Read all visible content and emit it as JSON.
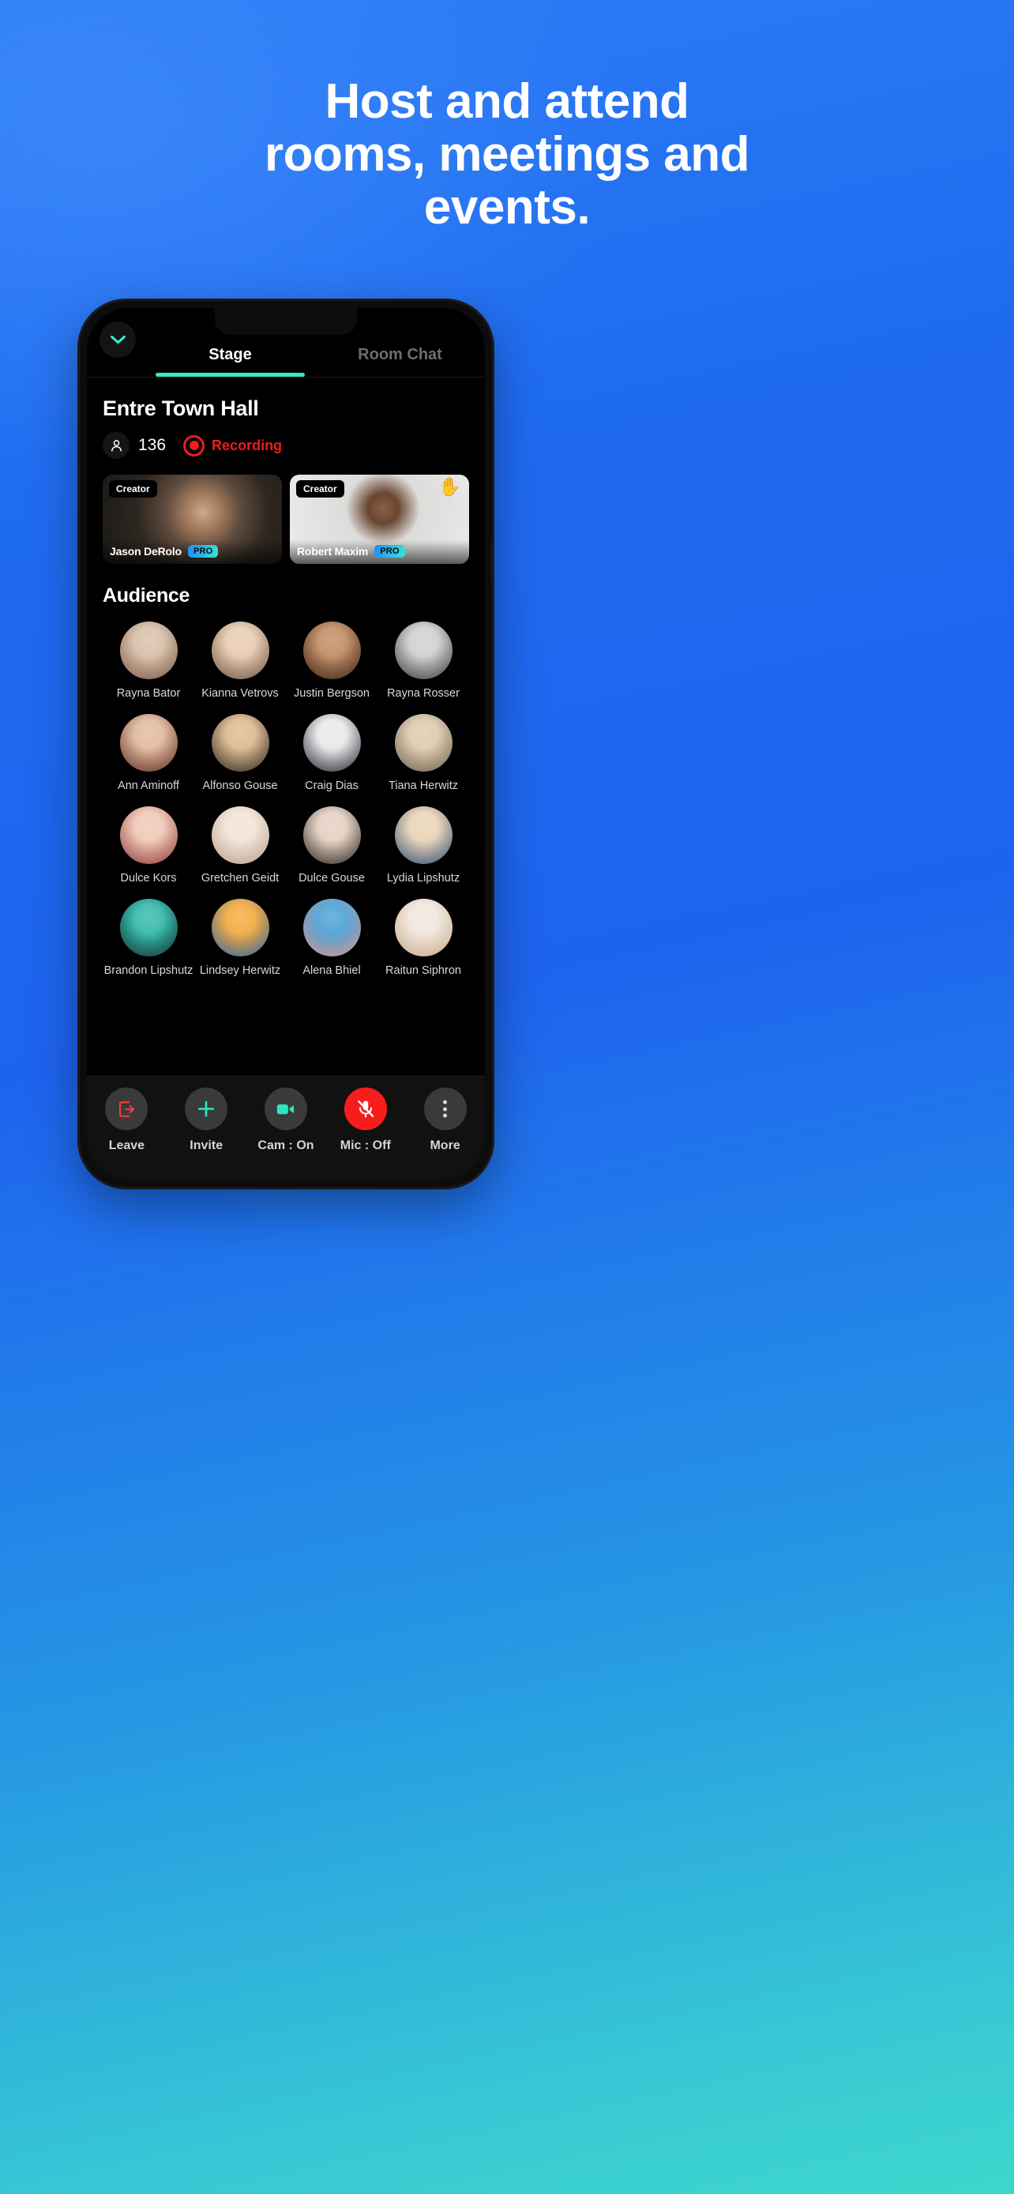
{
  "headline": {
    "line1": "Host and attend",
    "line2": "rooms, meetings and",
    "line3": "events."
  },
  "colors": {
    "accent_teal": "#3ce7c4",
    "recording_red": "#f01b1b",
    "pro_gradient_start": "#1e8bff",
    "pro_gradient_end": "#3ae3d2",
    "background_blue": "#1f6bf0",
    "background_cyan": "#3ed6cc"
  },
  "app": {
    "collapse_icon": "chevron-down-icon",
    "tabs": [
      {
        "label": "Stage",
        "active": true
      },
      {
        "label": "Room Chat",
        "active": false
      }
    ],
    "room": {
      "title": "Entre Town Hall",
      "participant_icon": "person-icon",
      "participant_count": "136",
      "recording_icon": "record-circle-icon",
      "recording_label": "Recording"
    },
    "speakers": [
      {
        "badge": "Creator",
        "name": "Jason DeRolo",
        "pro_label": "PRO",
        "hand_raised": false,
        "hand_icon": ""
      },
      {
        "badge": "Creator",
        "name": "Robert Maxim",
        "pro_label": "PRO",
        "hand_raised": true,
        "hand_icon": "✋"
      }
    ],
    "audience": {
      "title": "Audience",
      "members": [
        {
          "name": "Rayna Bator",
          "c1": "#d8bfa8",
          "c2": "#7a5a4a"
        },
        {
          "name": "Kianna Vetrovs",
          "c1": "#e8cbb0",
          "c2": "#6b5340"
        },
        {
          "name": "Justin Bergson",
          "c1": "#c08a62",
          "c2": "#3a2318"
        },
        {
          "name": "Rayna Rosser",
          "c1": "#cfcfcf",
          "c2": "#3a3a3a"
        },
        {
          "name": "Ann Aminoff",
          "c1": "#e0b89c",
          "c2": "#5e2e24"
        },
        {
          "name": "Alfonso Gouse",
          "c1": "#ddb98f",
          "c2": "#2b2620"
        },
        {
          "name": "Craig Dias",
          "c1": "#e8e8e8",
          "c2": "#1e2230"
        },
        {
          "name": "Tiana Herwitz",
          "c1": "#ddc9ad",
          "c2": "#6d6253"
        },
        {
          "name": "Dulce Kors",
          "c1": "#f0c6b4",
          "c2": "#8b3a3a"
        },
        {
          "name": "Gretchen Geidt",
          "c1": "#f2e3d6",
          "c2": "#b9a08c"
        },
        {
          "name": "Dulce Gouse",
          "c1": "#e3cfc0",
          "c2": "#2a2320"
        },
        {
          "name": "Lydia Lipshutz",
          "c1": "#e9d3b4",
          "c2": "#2f4d7a"
        },
        {
          "name": "Brandon Lipshutz",
          "c1": "#2fb8a8",
          "c2": "#18312f"
        },
        {
          "name": "Lindsey Herwitz",
          "c1": "#f2a93b",
          "c2": "#2c63a8"
        },
        {
          "name": "Alena Bhiel",
          "c1": "#4a9fd4",
          "c2": "#e09a90"
        },
        {
          "name": "Raitun Siphron",
          "c1": "#f0e6dc",
          "c2": "#c8a98c"
        }
      ]
    },
    "bottom_bar": [
      {
        "label": "Leave",
        "icon": "leave-icon",
        "danger": false
      },
      {
        "label": "Invite",
        "icon": "plus-icon",
        "danger": false
      },
      {
        "label": "Cam : On",
        "icon": "camera-icon",
        "danger": false
      },
      {
        "label": "Mic : Off",
        "icon": "mic-muted-icon",
        "danger": true
      },
      {
        "label": "More",
        "icon": "more-dots-icon",
        "danger": false
      }
    ]
  }
}
